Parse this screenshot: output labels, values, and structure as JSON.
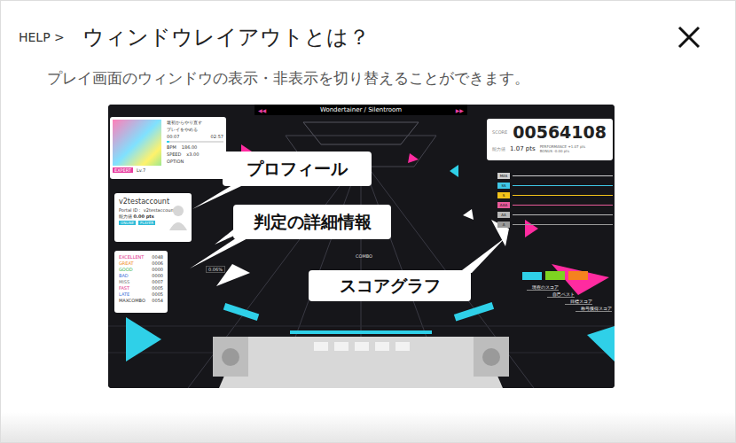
{
  "help": {
    "breadcrumb": "HELP >",
    "title": "ウィンドウレイアウトとは？",
    "description": "プレイ画面のウィンドウの表示・非表示を切り替えることができます。"
  },
  "screenshot": {
    "song": {
      "left_arrows": "◀◀",
      "title": "Wondertainer / Silentroom",
      "right_arrows": "▶▶"
    },
    "play_panel": {
      "menu": [
        "最初からやり直す",
        "プレイをやめる"
      ],
      "time_current": "00:07",
      "time_total": "02:57",
      "time_level": 0.04,
      "difficulty": "EXPERT",
      "level_label": "Lv.7",
      "rows": [
        {
          "label": "BPM",
          "value": "186.00"
        },
        {
          "label": "SPEED",
          "value": "x3.00"
        },
        {
          "label": "OPTION",
          "value": ""
        }
      ]
    },
    "score_panel": {
      "label": "SCORE",
      "score": "00564108",
      "rating_label": "能力値",
      "rating": "1.07 pts",
      "details": [
        "PERFORMANCE +1.07 pts",
        "BONUS -0.00 pts"
      ]
    },
    "profile": {
      "name": "v2testaccount",
      "portal_label": "Portal ID：",
      "portal_id": "v2testaccount",
      "rating_label": "能力値",
      "rating": "0.00 pts",
      "badges": [
        {
          "label": "ONLINE",
          "color": "#2bbbd8"
        },
        {
          "label": "PLAYER",
          "color": "#2bbbd8"
        }
      ]
    },
    "judgements": [
      {
        "label": "EXCELLENT",
        "count": "0048",
        "color": "#e0308a"
      },
      {
        "label": "GREAT",
        "count": "0006",
        "color": "#f08a1c"
      },
      {
        "label": "GOOD",
        "count": "0000",
        "color": "#39b54a"
      },
      {
        "label": "BAD",
        "count": "0000",
        "color": "#3b6fd8"
      },
      {
        "label": "MISS",
        "count": "0007",
        "color": "#777777"
      },
      {
        "label": "FAST",
        "count": "0005",
        "color": "#e0308a"
      },
      {
        "label": "LATE",
        "count": "0005",
        "color": "#3b6fd8"
      },
      {
        "label": "MAXCOMBO",
        "count": "0054",
        "color": "#333333"
      }
    ],
    "combo_label": "COMBO",
    "accuracy": "0.06%",
    "rank_lines": [
      {
        "label": "MAS",
        "color": "#cfcfcf"
      },
      {
        "label": "SS",
        "color": "#3fc7e6"
      },
      {
        "label": "S",
        "color": "#f2c21a"
      },
      {
        "label": "AAA",
        "color": "#e85a9a"
      },
      {
        "label": "AA",
        "color": "#b8b8b8"
      },
      {
        "label": "A",
        "color": "#9a9a9a"
      }
    ],
    "score_graph": {
      "max": 1010000,
      "bars": [
        {
          "label": "現在のスコア",
          "value": 564108,
          "color": "#2fd0e8"
        },
        {
          "label": "自己ベスト",
          "value": 600000,
          "color": "#7ed321"
        },
        {
          "label": "目標スコア",
          "value": 640000,
          "color": "#f5821f"
        },
        {
          "label": "称号獲得スコア",
          "value": 0,
          "color": "#ffffff"
        }
      ]
    },
    "callouts": [
      "プロフィール",
      "判定の詳細情報",
      "スコアグラフ"
    ]
  }
}
